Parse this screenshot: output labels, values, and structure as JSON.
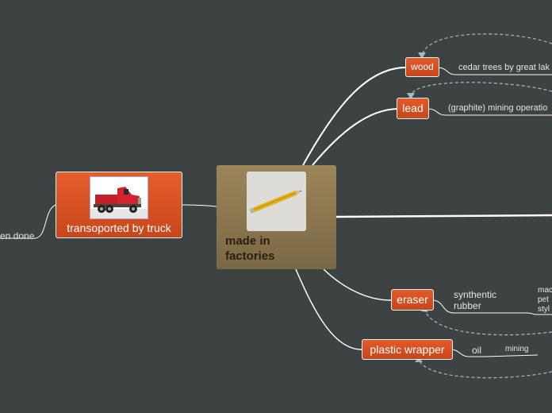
{
  "central": {
    "title": "made in factories",
    "image_icon": "pencil-icon"
  },
  "left": {
    "truck": {
      "label": "transoported by truck",
      "image_icon": "truck-icon"
    },
    "done_label": "en done"
  },
  "branches": {
    "wood": {
      "label": "wood",
      "detail": "cedar trees by great lak"
    },
    "lead": {
      "label": "lead",
      "detail": "(graphite) mining operatio"
    },
    "eraser": {
      "label": "eraser",
      "detail_lines": [
        "synthentic",
        "rubber"
      ],
      "sub_lines": [
        "mac",
        "pet",
        "styl"
      ]
    },
    "wrapper": {
      "label": "plastic wrapper",
      "detail": "oil",
      "sub": "mining"
    }
  },
  "colors": {
    "background": "#3d4242",
    "node": "#d5502a",
    "central": "#8c7850",
    "link": "#ffffff",
    "dashed_link": "#9fbcc4"
  }
}
